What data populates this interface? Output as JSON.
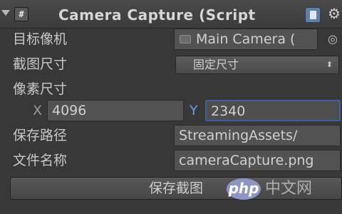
{
  "component": {
    "title": "Camera Capture (Script",
    "script_icon": "#",
    "icons": [
      "foldout-arrow-icon",
      "script-icon",
      "help-book-icon",
      "gear-icon"
    ]
  },
  "fields": {
    "target_camera": {
      "label": "目标像机",
      "value": "Main Camera (",
      "icon": "camera-icon",
      "picker_icon": "◎"
    },
    "capture_size": {
      "label": "截图尺寸",
      "value": "固定尺寸",
      "arrow": "⬍"
    },
    "pixel_size": {
      "label": "像素尺寸",
      "x_label": "X",
      "x_value": "4096",
      "y_label": "Y",
      "y_value": "2340"
    },
    "save_path": {
      "label": "保存路径",
      "value": "StreamingAssets/"
    },
    "file_name": {
      "label": "文件名称",
      "value": "cameraCapture.png"
    }
  },
  "button": {
    "label": "保存截图"
  },
  "watermark": {
    "logo": "php",
    "text": "中文网"
  },
  "colors": {
    "panel": "#383838",
    "field": "#525252",
    "focus_border": "#3e5f9e",
    "y_axis": "#6a9ee3"
  }
}
